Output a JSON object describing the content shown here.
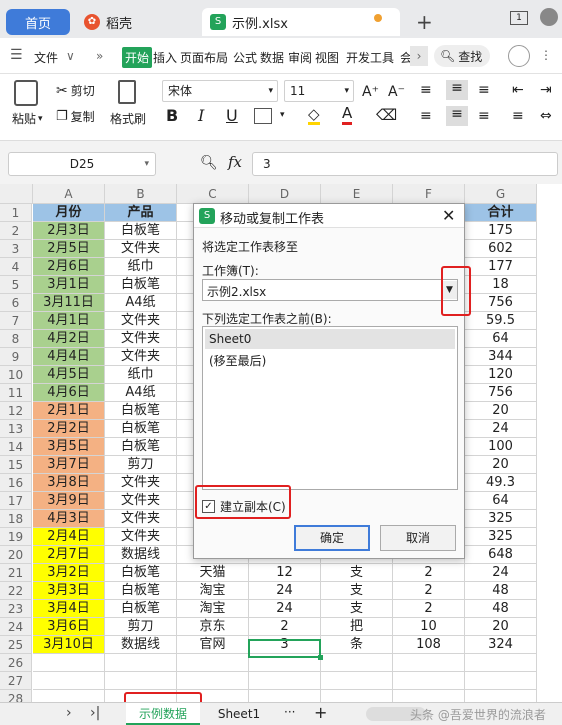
{
  "tabs": {
    "home": "首页",
    "docer": "稻壳",
    "file": "示例.xlsx",
    "add": "+"
  },
  "menu": {
    "file": "文件",
    "items": [
      "开始",
      "插入",
      "页面布局",
      "公式",
      "数据",
      "审阅",
      "视图",
      "开发工具",
      "会"
    ],
    "search": "查找"
  },
  "ribbon": {
    "paste": "粘贴",
    "cut": "剪切",
    "copy": "复制",
    "format_painter": "格式刷",
    "font_name": "宋体",
    "font_size": "11",
    "bold": "B",
    "italic": "I",
    "underline": "U",
    "font_color": "A"
  },
  "formula_bar": {
    "cell_ref": "D25",
    "fx": "fx",
    "value": "3"
  },
  "columns": [
    "A",
    "B",
    "C",
    "D",
    "E",
    "F",
    "G"
  ],
  "rows": [
    {
      "n": "1",
      "a": "月份",
      "b": "产品",
      "c": "",
      "d": "",
      "e": "",
      "f": "",
      "g": "合计"
    },
    {
      "n": "2",
      "a": "2月3日",
      "b": "白板笔",
      "c": "",
      "d": "",
      "e": "",
      "f": "",
      "g": "175"
    },
    {
      "n": "3",
      "a": "2月5日",
      "b": "文件夹",
      "c": "",
      "d": "",
      "e": "",
      "f": "",
      "g": "602"
    },
    {
      "n": "4",
      "a": "2月6日",
      "b": "纸巾",
      "c": "",
      "d": "",
      "e": "",
      "f": "",
      "g": "177"
    },
    {
      "n": "5",
      "a": "3月1日",
      "b": "白板笔",
      "c": "",
      "d": "",
      "e": "",
      "f": "",
      "g": "18"
    },
    {
      "n": "6",
      "a": "3月11日",
      "b": "A4纸",
      "c": "",
      "d": "",
      "e": "",
      "f": "",
      "g": "756"
    },
    {
      "n": "7",
      "a": "4月1日",
      "b": "文件夹",
      "c": "",
      "d": "",
      "e": "",
      "f": "",
      "g": "59.5"
    },
    {
      "n": "8",
      "a": "4月2日",
      "b": "文件夹",
      "c": "",
      "d": "",
      "e": "",
      "f": "",
      "g": "64"
    },
    {
      "n": "9",
      "a": "4月4日",
      "b": "文件夹",
      "c": "",
      "d": "",
      "e": "",
      "f": "",
      "g": "344"
    },
    {
      "n": "10",
      "a": "4月5日",
      "b": "纸巾",
      "c": "",
      "d": "",
      "e": "",
      "f": "",
      "g": "120"
    },
    {
      "n": "11",
      "a": "4月6日",
      "b": "A4纸",
      "c": "",
      "d": "",
      "e": "",
      "f": "",
      "g": "756"
    },
    {
      "n": "12",
      "a": "2月1日",
      "b": "白板笔",
      "c": "",
      "d": "",
      "e": "",
      "f": "",
      "g": "20"
    },
    {
      "n": "13",
      "a": "2月2日",
      "b": "白板笔",
      "c": "",
      "d": "",
      "e": "",
      "f": "",
      "g": "24"
    },
    {
      "n": "14",
      "a": "3月5日",
      "b": "白板笔",
      "c": "",
      "d": "",
      "e": "",
      "f": "",
      "g": "100"
    },
    {
      "n": "15",
      "a": "3月7日",
      "b": "剪刀",
      "c": "",
      "d": "",
      "e": "",
      "f": "",
      "g": "20"
    },
    {
      "n": "16",
      "a": "3月8日",
      "b": "文件夹",
      "c": "",
      "d": "",
      "e": "",
      "f": "",
      "g": "49.3"
    },
    {
      "n": "17",
      "a": "3月9日",
      "b": "文件夹",
      "c": "",
      "d": "",
      "e": "",
      "f": "",
      "g": "64"
    },
    {
      "n": "18",
      "a": "4月3日",
      "b": "文件夹",
      "c": "",
      "d": "",
      "e": "",
      "f": "",
      "g": "325"
    },
    {
      "n": "19",
      "a": "2月4日",
      "b": "文件夹",
      "c": "",
      "d": "",
      "e": "",
      "f": "",
      "g": "325"
    },
    {
      "n": "20",
      "a": "2月7日",
      "b": "数据线",
      "c": "",
      "d": "",
      "e": "",
      "f": "",
      "g": "648"
    },
    {
      "n": "21",
      "a": "3月2日",
      "b": "白板笔",
      "c": "天猫",
      "d": "12",
      "e": "支",
      "f": "2",
      "g": "24"
    },
    {
      "n": "22",
      "a": "3月3日",
      "b": "白板笔",
      "c": "淘宝",
      "d": "24",
      "e": "支",
      "f": "2",
      "g": "48"
    },
    {
      "n": "23",
      "a": "3月4日",
      "b": "白板笔",
      "c": "淘宝",
      "d": "24",
      "e": "支",
      "f": "2",
      "g": "48"
    },
    {
      "n": "24",
      "a": "3月6日",
      "b": "剪刀",
      "c": "京东",
      "d": "2",
      "e": "把",
      "f": "10",
      "g": "20"
    },
    {
      "n": "25",
      "a": "3月10日",
      "b": "数据线",
      "c": "官网",
      "d": "3",
      "e": "条",
      "f": "108",
      "g": "324"
    },
    {
      "n": "26",
      "a": "",
      "b": "",
      "c": "",
      "d": "",
      "e": "",
      "f": "",
      "g": ""
    },
    {
      "n": "27",
      "a": "",
      "b": "",
      "c": "",
      "d": "",
      "e": "",
      "f": "",
      "g": ""
    },
    {
      "n": "28",
      "a": "",
      "b": "",
      "c": "",
      "d": "",
      "e": "",
      "f": "",
      "g": ""
    }
  ],
  "colors": {
    "header_blue": "#9dc3e6",
    "green": "#a9d08e",
    "orange": "#f4b183",
    "yellow": "#ffff00",
    "accent": "#3f7bd9",
    "wps_green": "#23a35a",
    "highlight_red": "#e02020"
  },
  "dialog": {
    "title": "移动或复制工作表",
    "move_to_label": "将选定工作表移至",
    "workbook_label": "工作簿(T):",
    "workbook_value": "示例2.xlsx",
    "before_label": "下列选定工作表之前(B):",
    "sheets": [
      "Sheet0",
      "(移至最后)"
    ],
    "create_copy_label": "建立副本(C)",
    "create_copy_checked": true,
    "ok": "确定",
    "cancel": "取消"
  },
  "sheetbar": {
    "active_sheet": "示例数据",
    "other_sheet": "Sheet1",
    "more": "···",
    "add": "+"
  },
  "watermark": "头条 @吾爱世界的流浪者"
}
